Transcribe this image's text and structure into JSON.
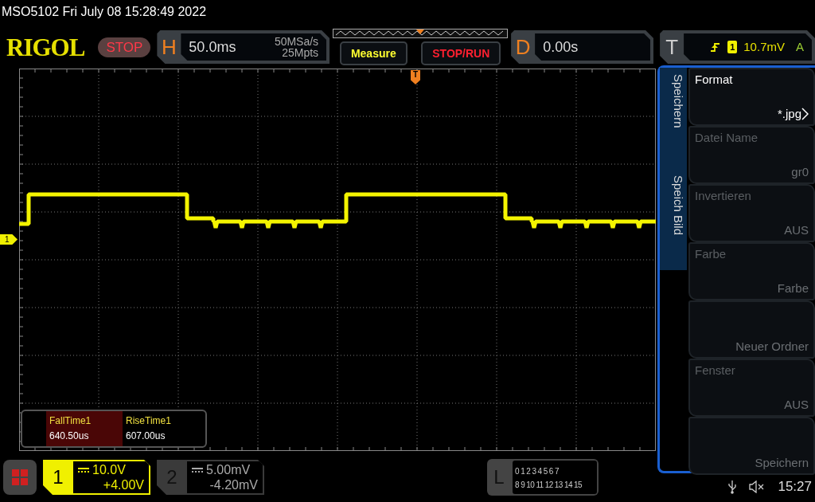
{
  "title_line": "MSO5102  Fri July 08 15:28:49 2022",
  "logo": "RIGOL",
  "run_state": "STOP",
  "horizontal": {
    "label": "H",
    "scale": "50.0ms",
    "sample_rate": "50MSa/s",
    "depth": "25Mpts"
  },
  "buttons": [
    "Measure",
    "STOP/RUN"
  ],
  "delay": {
    "label": "D",
    "value": "0.00s"
  },
  "trigger": {
    "label": "T",
    "source": "1",
    "level": "10.7mV",
    "mode": "A"
  },
  "trigger_marker": "T",
  "channel_marker": "1",
  "side_tabs": [
    "Speichern",
    "Speich Bild"
  ],
  "menu_items": [
    {
      "label": "Format",
      "value": "*.jpg",
      "disabled": false,
      "submenu": true
    },
    {
      "label": "Datei Name",
      "value": "gr0",
      "disabled": true,
      "submenu": false
    },
    {
      "label": "Invertieren",
      "value": "AUS",
      "disabled": true,
      "submenu": false
    },
    {
      "label": "Farbe",
      "value": "Farbe",
      "disabled": true,
      "submenu": false
    },
    {
      "value": "Neuer Ordner",
      "disabled": true,
      "submenu": false
    },
    {
      "label": "Fenster",
      "value": "AUS",
      "disabled": true,
      "submenu": false
    },
    {
      "value": "Speichern",
      "disabled": true,
      "submenu": false
    }
  ],
  "measurements": [
    {
      "name": "FallTime1",
      "value": "640.50us",
      "selected": true
    },
    {
      "name": "RiseTime1",
      "value": "607.00us",
      "selected": false
    }
  ],
  "channels": [
    {
      "number": "1",
      "scale": "10.0V",
      "offset": "+4.00V",
      "active": true
    },
    {
      "number": "2",
      "scale": "5.00mV",
      "offset": "-4.20mV",
      "active": false
    }
  ],
  "logic": {
    "label": "L",
    "row_1": "0 1 2 3  4 5 6 7",
    "row_2": "8 9 10 11 12 13 14 15"
  },
  "status_time": "15:27"
}
